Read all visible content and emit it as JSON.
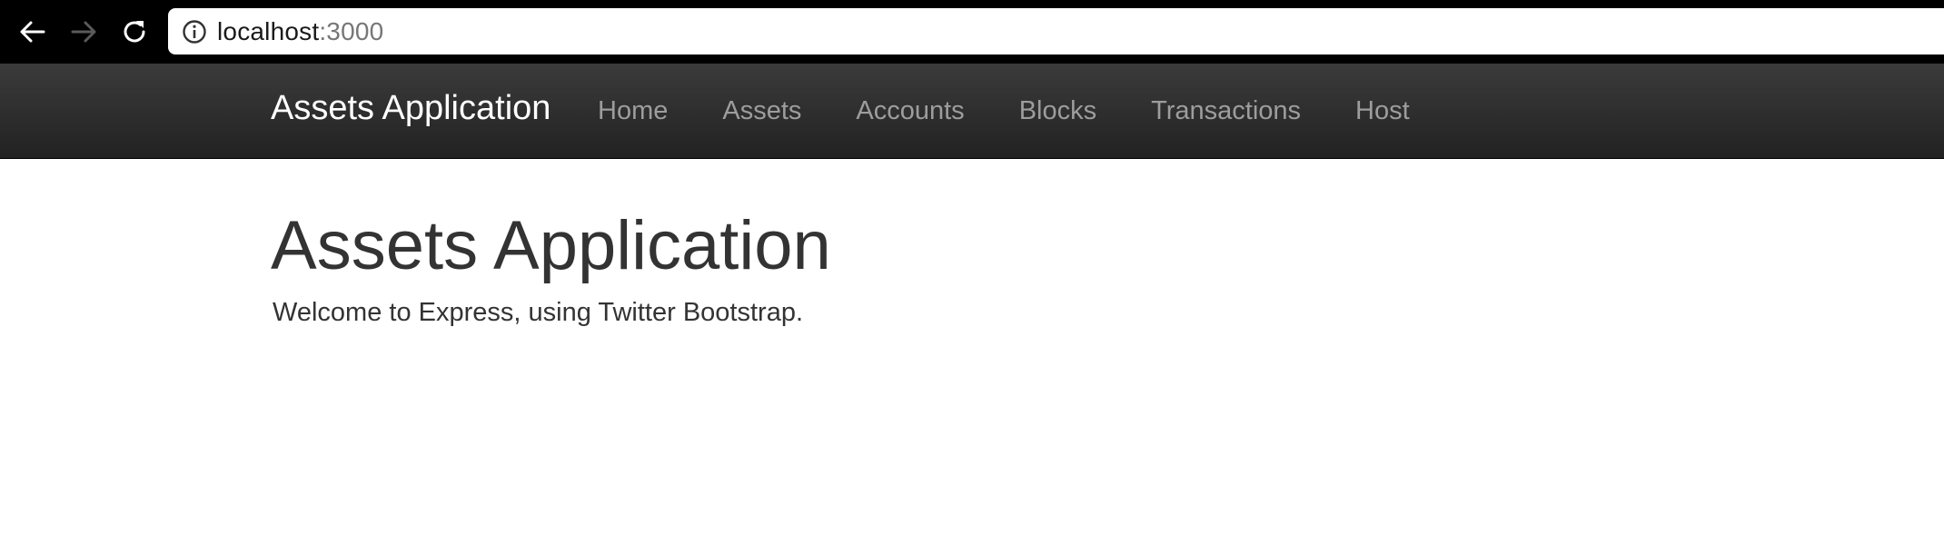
{
  "browser": {
    "url_host": "localhost",
    "url_port": ":3000",
    "back_icon": "arrow-left-icon",
    "forward_icon": "arrow-right-icon",
    "reload_icon": "reload-icon",
    "info_icon": "info-circle-icon"
  },
  "navbar": {
    "brand": "Assets Application",
    "items": [
      {
        "label": "Home"
      },
      {
        "label": "Assets"
      },
      {
        "label": "Accounts"
      },
      {
        "label": "Blocks"
      },
      {
        "label": "Transactions"
      },
      {
        "label": "Host"
      }
    ]
  },
  "main": {
    "title": "Assets Application",
    "lead": "Welcome to Express, using Twitter Bootstrap."
  },
  "colors": {
    "navbar_bg": "#222222",
    "navbar_link": "#9d9d9d",
    "brand": "#ffffff",
    "text": "#333333"
  }
}
